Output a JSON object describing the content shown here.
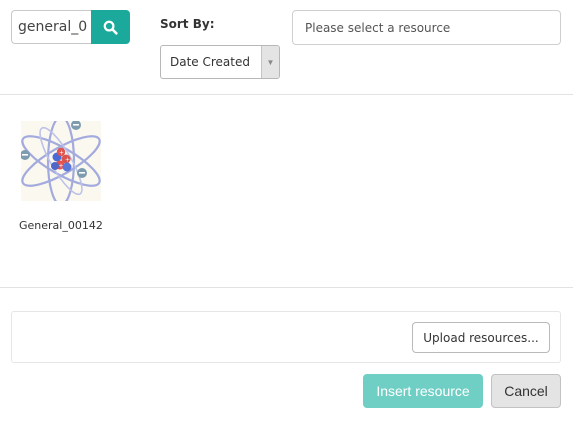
{
  "search": {
    "value": "general_0",
    "icon": "search-icon",
    "button_color": "#1aa99b"
  },
  "sort": {
    "label": "Sort By:",
    "selected": "Date Created",
    "icon": "chevron-down-icon"
  },
  "resource_select": {
    "placeholder": "Please select a resource"
  },
  "results": [
    {
      "name": "General_00142",
      "thumbnail": "atom-icon"
    }
  ],
  "footer": {
    "upload_label": "Upload resources...",
    "insert_label": "Insert resource",
    "cancel_label": "Cancel",
    "insert_color": "#6fcfc4"
  }
}
